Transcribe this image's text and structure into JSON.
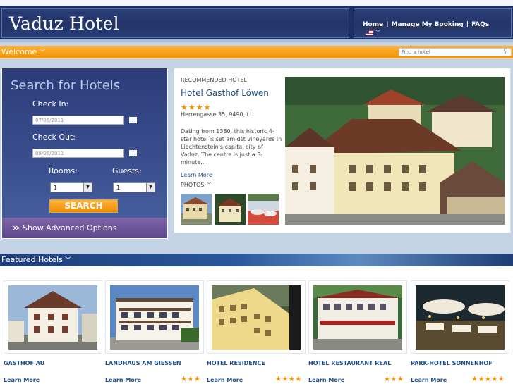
{
  "header": {
    "title": "Vaduz Hotel",
    "nav": [
      "Home",
      "Manage My Booking",
      "FAQs"
    ],
    "nav_separator": "|"
  },
  "welcome_bar": {
    "label": "Welcome",
    "search_placeholder": "Find a hotel"
  },
  "search": {
    "title": "Search for Hotels",
    "checkin_label": "Check In:",
    "checkin_value": "07/06/2011",
    "checkout_label": "Check Out:",
    "checkout_value": "08/06/2011",
    "rooms_label": "Rooms:",
    "rooms_value": "1",
    "guests_label": "Guests:",
    "guests_value": "1",
    "submit_label": "SEARCH",
    "advanced_label": "Show Advanced Options"
  },
  "recommended": {
    "kicker": "RECOMMENDED HOTEL",
    "name": "Hotel Gasthof Löwen",
    "stars": "★★★★",
    "address": "Herrengasse 35, 9490, LI",
    "description": "Dating from 1380, this historic 4-star hotel is set amidst vineyards in Liechtenstein's capital city of Vaduz. The centre is just a 3-minute...",
    "learn_more": "Learn More",
    "photos_label": "PHOTOS"
  },
  "featured": {
    "label": "Featured Hotels",
    "hotels": [
      {
        "name": "GASTHOF AU",
        "learn": "Learn More",
        "stars": ""
      },
      {
        "name": "LANDHAUS AM GIESSEN",
        "learn": "Learn More",
        "stars": "★★★"
      },
      {
        "name": "HOTEL RESIDENCE",
        "learn": "Learn More",
        "stars": "★★★★"
      },
      {
        "name": "HOTEL RESTAURANT REAL",
        "learn": "Learn More",
        "stars": "★★★"
      },
      {
        "name": "PARK-HOTEL SONNENHOF",
        "learn": "Learn More",
        "stars": "★★★★★"
      }
    ]
  },
  "colors": {
    "navy": "#1b2f62",
    "orange": "#f39200",
    "link_blue": "#1f4e86",
    "purple": "#6a5296"
  },
  "icons": [
    "calendar-icon",
    "chevron-down-icon",
    "search-icon",
    "flag-icon"
  ]
}
